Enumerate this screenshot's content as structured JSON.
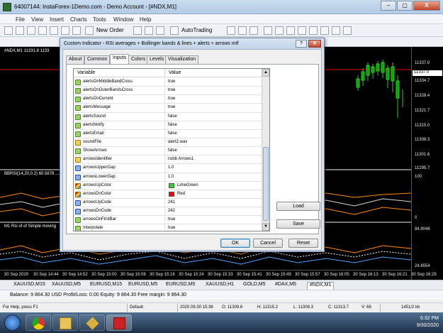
{
  "window": {
    "title": "64007144: InstaForex-1Demo.com - Demo Account - [#NDX,M1]",
    "buttons": [
      "–",
      "▢",
      "X"
    ]
  },
  "menu": [
    "File",
    "View",
    "Insert",
    "Charts",
    "Tools",
    "Window",
    "Help"
  ],
  "toolbar": {
    "new_order": "New Order",
    "auto_trading": "AutoTrading"
  },
  "chart": {
    "symbol_label": "#NDX,M1  11331.8 1133",
    "price_labels": [
      "11337.0",
      "11334.7",
      "11328.4",
      "11321.7",
      "11315.0",
      "11308.3",
      "11301.6",
      "11295.7"
    ],
    "current_price": "11337.0",
    "indicator1_label": "BBRSI(14,20,0.2) 60.5678 ...",
    "indicator1_axis": [
      "100",
      "0"
    ],
    "indicator2_label": "M1 Rsi of of Simple moving",
    "indicator2_axis": [
      "84.9046",
      "24.6554"
    ],
    "time_labels": [
      "30 Sep 2020",
      "30 Sep 14:44",
      "30 Sep 14:52",
      "30 Sep 15:00",
      "30 Sep 15:08",
      "30 Sep 15:16",
      "30 Sep 15:24",
      "30 Sep 15:33",
      "30 Sep 15:41",
      "30 Sep 15:49",
      "30 Sep 15:57",
      "30 Sep 16:05",
      "30 Sep 16:13",
      "30 Sep 16:21",
      "30 Sep 16:29"
    ]
  },
  "dialog": {
    "title": "Custom Indicator - RSI averages + Bollinger bands & lines + alerts + arrows mtf",
    "help": "?",
    "close": "X",
    "tabs": [
      "About",
      "Common",
      "Inputs",
      "Colors",
      "Levels",
      "Visualization"
    ],
    "active_tab": "Inputs",
    "grid": {
      "col_variable": "Variable",
      "col_value": "Value",
      "rows": [
        {
          "icon": "bool",
          "name": "alertsOnMiddleBandCross",
          "value": "true"
        },
        {
          "icon": "bool",
          "name": "alertsOnOuterBandsCross",
          "value": "true"
        },
        {
          "icon": "bool",
          "name": "alertsOnCurrent",
          "value": "true"
        },
        {
          "icon": "bool",
          "name": "alertsMessage",
          "value": "true"
        },
        {
          "icon": "bool",
          "name": "alertsSound",
          "value": "false"
        },
        {
          "icon": "bool",
          "name": "alertsNotify",
          "value": "false"
        },
        {
          "icon": "bool",
          "name": "alertsEmail",
          "value": "false"
        },
        {
          "icon": "ab",
          "name": "soundFile",
          "value": "alert2.wav"
        },
        {
          "icon": "bool",
          "name": "ShowArrows",
          "value": "false"
        },
        {
          "icon": "ab",
          "name": "arrowsIdentifier",
          "value": "rsibb Arrows1"
        },
        {
          "icon": "num",
          "name": "arrowsUpperGap",
          "value": "1.0"
        },
        {
          "icon": "num",
          "name": "arrowsLowerGap",
          "value": "1.0"
        },
        {
          "icon": "col",
          "name": "arrowsUpColor",
          "value": "LimeGreen",
          "swatch": "#32cd32"
        },
        {
          "icon": "col",
          "name": "arrowsDnColor",
          "value": "Red",
          "swatch": "#ff0000"
        },
        {
          "icon": "num",
          "name": "arrowsUpCode",
          "value": "241"
        },
        {
          "icon": "num",
          "name": "arrowsDnCode",
          "value": "242"
        },
        {
          "icon": "bool",
          "name": "arrowsOnFirstBar",
          "value": "true"
        },
        {
          "icon": "bool",
          "name": "Interpolate",
          "value": "true"
        }
      ]
    },
    "load": "Load",
    "save": "Save",
    "ok": "OK",
    "cancel": "Cancel",
    "reset": "Reset"
  },
  "tabs": [
    "XAUUSD,M15",
    "XAUUSD,M5",
    "EURUSD,M15",
    "EURUSD,M5",
    "EURUSD,M5",
    "XAUUSD,H1",
    "GOLD,M5",
    "#DAX,M5",
    "#NDX,M1"
  ],
  "active_chart_tab": "#NDX,M1",
  "account": "Balance: 9 864.30 USD  Profit/Loss: 0.00  Equity: 9 864.30  Free margin: 9 864.30",
  "status": {
    "help": "For Help, press F1",
    "profile": "Default",
    "time": "2020.09.30 15:36",
    "open": "O: 11309.6",
    "high": "H: 11315.2",
    "low": "L: 11308.3",
    "close": "C: 11313.7",
    "volume": "V: 68",
    "traffic": "1451/2 kb"
  },
  "tray": {
    "time": "6:32 PM",
    "date": "9/30/2020"
  }
}
